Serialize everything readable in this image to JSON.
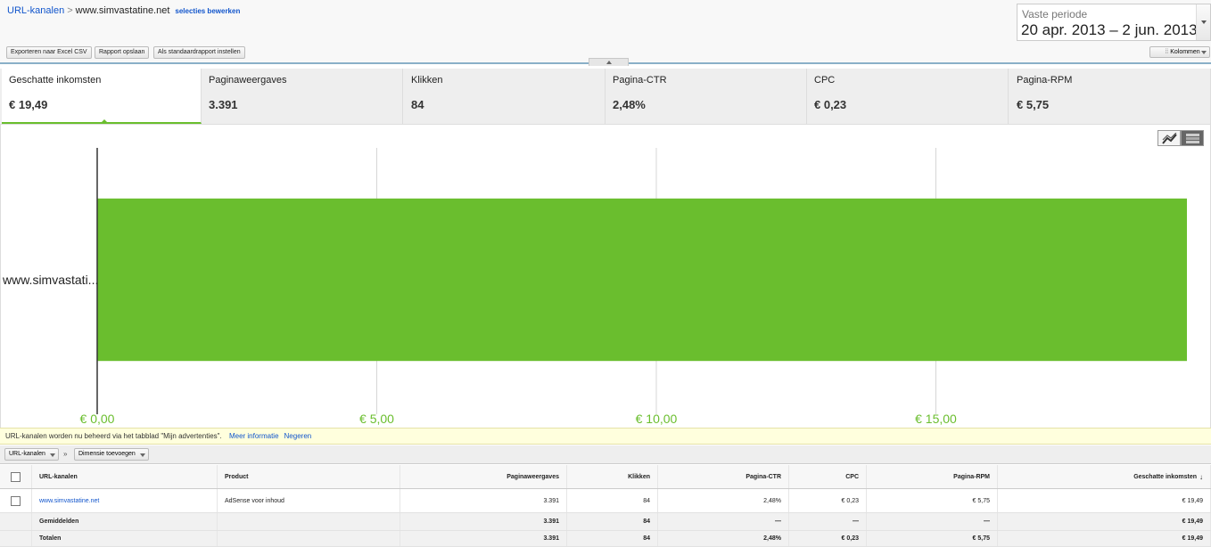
{
  "breadcrumb": {
    "parent": "URL-kanalen",
    "separator": ">",
    "current": "www.simvastatine.net",
    "edit_link": "selecties bewerken"
  },
  "toolbar": {
    "export_label": "Exporteren naar Excel CSV",
    "save_label": "Rapport opslaan",
    "default_label": "Als standaardrapport instellen",
    "columns_label": "Kolommen"
  },
  "period": {
    "label": "Vaste periode",
    "range": "20 apr. 2013 – 2 jun. 2013"
  },
  "metrics": [
    {
      "name": "Geschatte inkomsten",
      "value": "€ 19,49",
      "active": true
    },
    {
      "name": "Paginaweergaves",
      "value": "3.391",
      "active": false
    },
    {
      "name": "Klikken",
      "value": "84",
      "active": false
    },
    {
      "name": "Pagina-CTR",
      "value": "2,48%",
      "active": false
    },
    {
      "name": "CPC",
      "value": "€ 0,23",
      "active": false
    },
    {
      "name": "Pagina-RPM",
      "value": "€ 5,75",
      "active": false
    }
  ],
  "chart_data": {
    "type": "bar",
    "orientation": "horizontal",
    "categories": [
      "www.simvastati..."
    ],
    "values": [
      19.49
    ],
    "xlim": [
      0,
      19.49
    ],
    "xticks": [
      0,
      5,
      10,
      15
    ],
    "xtick_labels": [
      "€ 0,00",
      "€ 5,00",
      "€ 10,00",
      "€ 15,00"
    ],
    "bar_color": "#6abe2e",
    "grid": true
  },
  "notice": {
    "text": "URL-kanalen worden nu beheerd via het tabblad \"Mijn advertenties\".",
    "more_info": "Meer informatie",
    "ignore": "Negeren"
  },
  "dimensions": {
    "primary": "URL-kanalen",
    "arrow": "»",
    "add": "Dimensie toevoegen"
  },
  "table": {
    "headers": [
      "URL-kanalen",
      "Product",
      "Paginaweergaves",
      "Klikken",
      "Pagina-CTR",
      "CPC",
      "Pagina-RPM",
      "Geschatte inkomsten"
    ],
    "sort_indicator": "↓",
    "rows": [
      [
        "www.simvastatine.net",
        "AdSense voor inhoud",
        "3.391",
        "84",
        "2,48%",
        "€ 0,23",
        "€ 5,75",
        "€ 19,49"
      ]
    ],
    "average": [
      "Gemiddelden",
      "",
      "3.391",
      "84",
      "—",
      "—",
      "—",
      "€ 19,49"
    ],
    "totals": [
      "Totalen",
      "",
      "3.391",
      "84",
      "2,48%",
      "€ 0,23",
      "€ 5,75",
      "€ 19,49"
    ]
  }
}
